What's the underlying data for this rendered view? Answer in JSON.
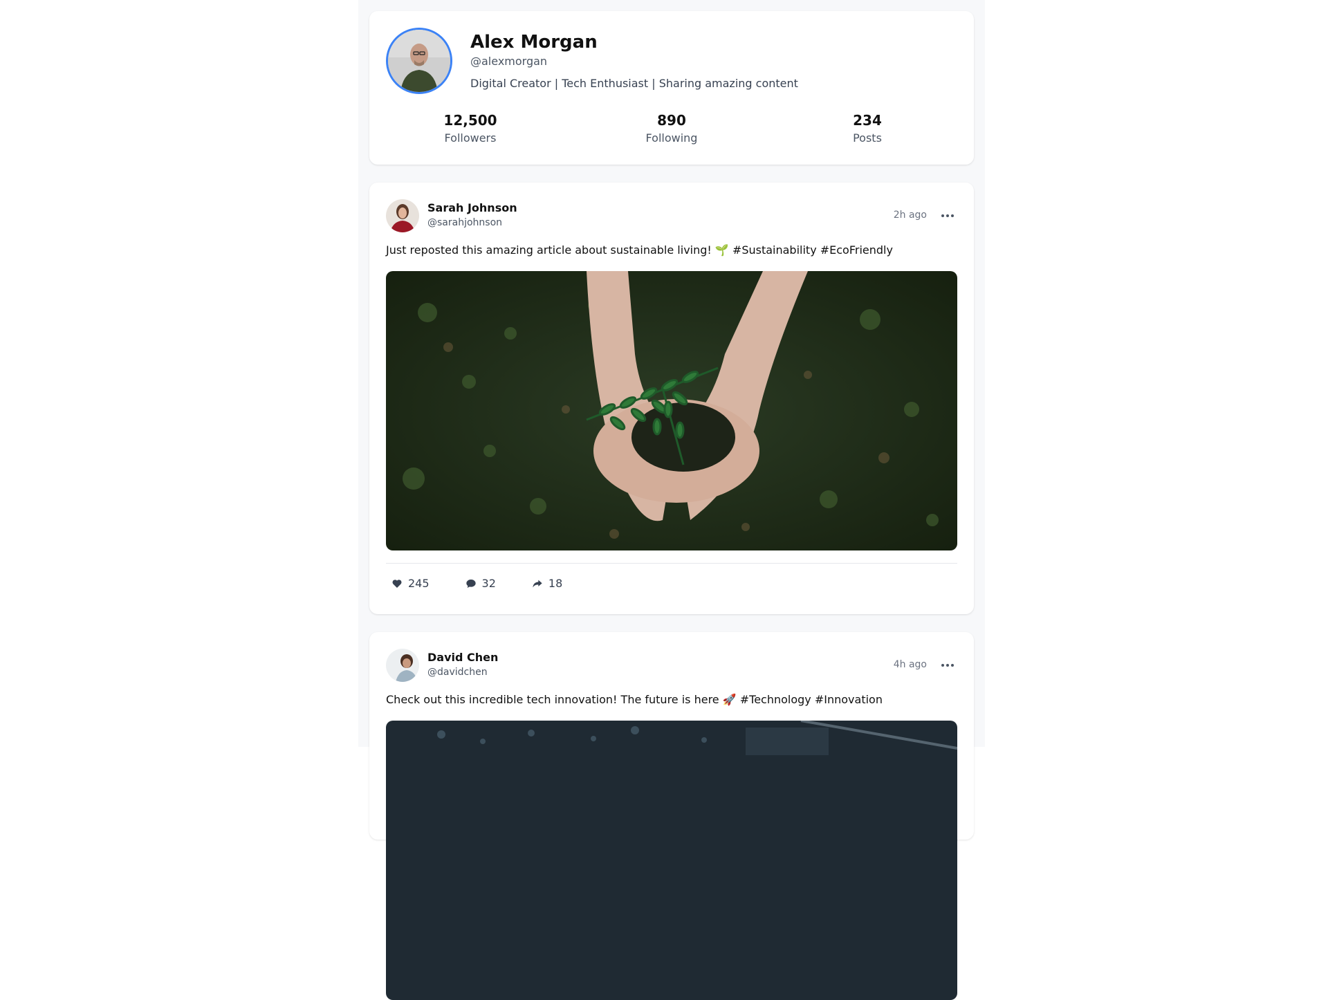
{
  "profile": {
    "name": "Alex Morgan",
    "handle": "@alexmorgan",
    "bio": "Digital Creator | Tech Enthusiast | Sharing amazing content",
    "stats": [
      {
        "value": "12,500",
        "label": "Followers"
      },
      {
        "value": "890",
        "label": "Following"
      },
      {
        "value": "234",
        "label": "Posts"
      }
    ]
  },
  "posts": [
    {
      "author": "Sarah Johnson",
      "handle": "@sarahjohnson",
      "time": "2h ago",
      "text": "Just reposted this amazing article about sustainable living! 🌱 #Sustainability #EcoFriendly",
      "likes": "245",
      "comments": "32",
      "shares": "18"
    },
    {
      "author": "David Chen",
      "handle": "@davidchen",
      "time": "4h ago",
      "text": "Check out this incredible tech innovation! The future is here 🚀 #Technology #Innovation"
    }
  ],
  "colors": {
    "accent": "#3b82f6",
    "page_background": "#f7f8fa",
    "card": "#ffffff"
  },
  "icons": [
    "heart-icon",
    "comment-icon",
    "share-icon",
    "more-icon"
  ]
}
